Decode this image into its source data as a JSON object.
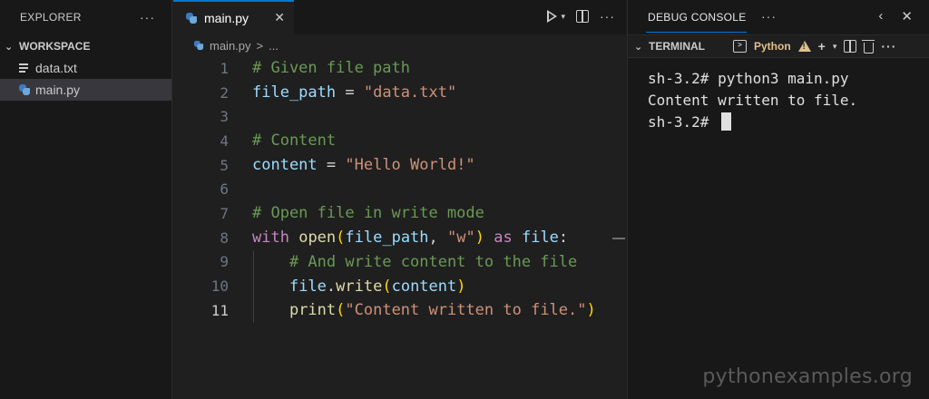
{
  "explorer": {
    "title": "EXPLORER",
    "more": "···",
    "section": "WORKSPACE",
    "files": [
      {
        "name": "data.txt",
        "icon": "text-file-icon",
        "selected": false
      },
      {
        "name": "main.py",
        "icon": "python-file-icon",
        "selected": true
      }
    ]
  },
  "editor": {
    "tab": {
      "label": "main.py",
      "close": "✕"
    },
    "breadcrumb": {
      "file": "main.py",
      "separator": ">",
      "more": "..."
    },
    "more": "···",
    "active_line": 11,
    "lines": [
      {
        "num": "1",
        "tokens": [
          [
            "t-comment",
            "# Given file path"
          ]
        ]
      },
      {
        "num": "2",
        "tokens": [
          [
            "t-var",
            "file_path"
          ],
          [
            "t-op",
            " = "
          ],
          [
            "t-str",
            "\"data.txt\""
          ]
        ]
      },
      {
        "num": "3",
        "tokens": []
      },
      {
        "num": "4",
        "tokens": [
          [
            "t-comment",
            "# Content"
          ]
        ]
      },
      {
        "num": "5",
        "tokens": [
          [
            "t-var",
            "content"
          ],
          [
            "t-op",
            " = "
          ],
          [
            "t-str",
            "\"Hello World!\""
          ]
        ]
      },
      {
        "num": "6",
        "tokens": []
      },
      {
        "num": "7",
        "tokens": [
          [
            "t-comment",
            "# Open file in write mode"
          ]
        ]
      },
      {
        "num": "8",
        "tokens": [
          [
            "t-kw",
            "with"
          ],
          [
            "t-op",
            " "
          ],
          [
            "t-fn",
            "open"
          ],
          [
            "t-p1",
            "("
          ],
          [
            "t-var",
            "file_path"
          ],
          [
            "t-op",
            ", "
          ],
          [
            "t-str",
            "\"w\""
          ],
          [
            "t-p1",
            ")"
          ],
          [
            "t-op",
            " "
          ],
          [
            "t-kw",
            "as"
          ],
          [
            "t-op",
            " "
          ],
          [
            "t-var",
            "file"
          ],
          [
            "t-op",
            ":"
          ]
        ]
      },
      {
        "num": "9",
        "tokens": [
          [
            "t-op",
            "    "
          ],
          [
            "t-comment",
            "# And write content to the file"
          ]
        ],
        "guide": true
      },
      {
        "num": "10",
        "tokens": [
          [
            "t-op",
            "    "
          ],
          [
            "t-var",
            "file"
          ],
          [
            "t-op",
            "."
          ],
          [
            "t-fn",
            "write"
          ],
          [
            "t-p1",
            "("
          ],
          [
            "t-var",
            "content"
          ],
          [
            "t-p1",
            ")"
          ]
        ],
        "guide": true
      },
      {
        "num": "11",
        "tokens": [
          [
            "t-op",
            "    "
          ],
          [
            "t-fn",
            "print"
          ],
          [
            "t-p1",
            "("
          ],
          [
            "t-str",
            "\"Content written to file.\""
          ],
          [
            "t-p1",
            ")"
          ]
        ],
        "guide": true
      }
    ]
  },
  "panel": {
    "tab": "DEBUG CONSOLE",
    "more": "···",
    "nav_prev": "‹",
    "nav_close": "✕",
    "terminal_header": "TERMINAL",
    "shell_label": "Python",
    "add": "+",
    "more2": "···",
    "terminal_lines": [
      "sh-3.2# python3 main.py",
      "Content written to file.",
      "sh-3.2# "
    ]
  },
  "watermark": "pythonexamples.org",
  "colors": {
    "accent": "#0078d4",
    "comment": "#6a9955",
    "variable": "#9cdcfe",
    "string": "#ce9178",
    "keyword": "#c586c0",
    "function": "#dcdcaa",
    "bracket": "#ffd700"
  }
}
